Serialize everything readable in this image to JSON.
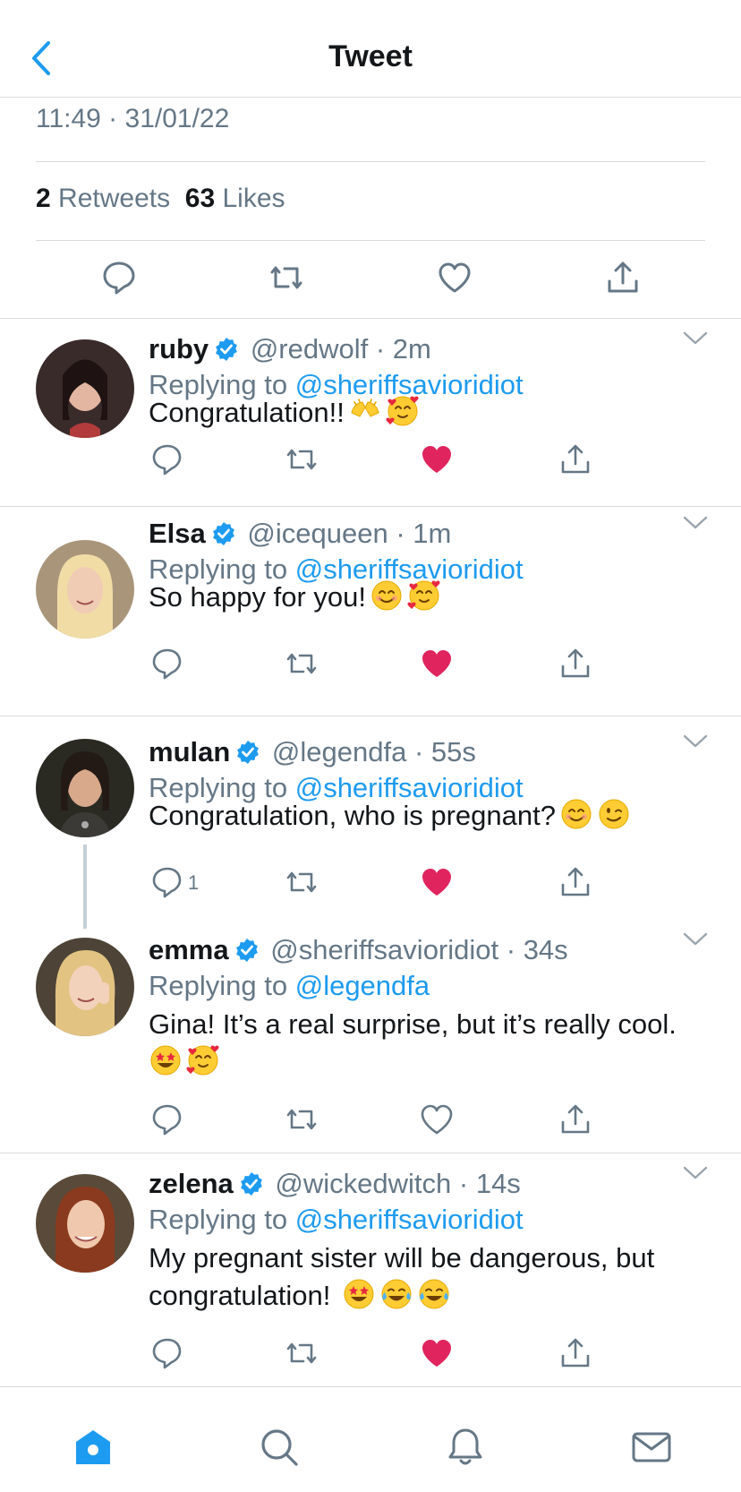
{
  "header": {
    "title": "Tweet",
    "back_icon": "chevron-left-icon"
  },
  "tweet": {
    "timestamp": "11:49 · 31/01/22",
    "retweets_count": "2",
    "retweets_label": "Retweets",
    "likes_count": "63",
    "likes_label": "Likes"
  },
  "replying_label": "Replying to",
  "colors": {
    "accent": "#1d9bf0",
    "like_red": "#e0245e",
    "muted": "#657786"
  },
  "replies": [
    {
      "name": "ruby",
      "handle": "@redwolf",
      "time": "2m",
      "replying_to": "@sheriffsavioridiot",
      "text": "Congratulation!!",
      "emojis": [
        "hands",
        "hearts"
      ],
      "liked": true,
      "reply_count": ""
    },
    {
      "name": "Elsa",
      "handle": "@icequeen",
      "time": "1m",
      "replying_to": "@sheriffsavioridiot",
      "text": "So happy for you!",
      "emojis": [
        "smile",
        "hearts"
      ],
      "liked": true,
      "reply_count": ""
    },
    {
      "name": "mulan",
      "handle": "@legendfa",
      "time": "55s",
      "replying_to": "@sheriffsavioridiot",
      "text": "Congratulation, who is pregnant?",
      "emojis": [
        "smile",
        "wink"
      ],
      "liked": true,
      "reply_count": "1"
    },
    {
      "name": "emma",
      "handle": "@sheriffsavioridiot",
      "time": "34s",
      "replying_to": "@legendfa",
      "text": "Gina! It’s a real surprise, but it’s really cool.",
      "emojis": [
        "starstruck",
        "hearts"
      ],
      "liked": false,
      "reply_count": ""
    },
    {
      "name": "zelena",
      "handle": "@wickedwitch",
      "time": "14s",
      "replying_to": "@sheriffsavioridiot",
      "text_line1": "My pregnant sister will be dangerous, but",
      "text_line2": "congratulation!",
      "emojis": [
        "starstruck",
        "joy",
        "joy"
      ],
      "liked": true,
      "reply_count": ""
    }
  ],
  "tabbar": {
    "tabs": [
      "home-icon",
      "search-icon",
      "bell-icon",
      "mail-icon"
    ]
  }
}
